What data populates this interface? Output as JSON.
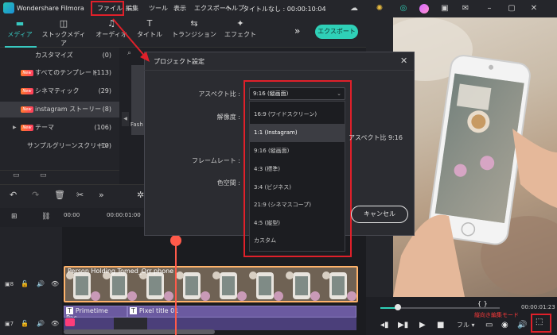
{
  "titlebar": {
    "app_name": "Wondershare Filmora",
    "menus": [
      "ファイル",
      "編集",
      "ツール",
      "表示",
      "エクスポート",
      "ヘルプ"
    ],
    "project_title": "タイトルなし : 00:00:10:04"
  },
  "toolbar": {
    "tools": [
      "メディア",
      "ストックメディア",
      "オーディオ",
      "タイトル",
      "トランジション",
      "エフェクト"
    ],
    "export_label": "エクスポート"
  },
  "left_panel": {
    "items": [
      {
        "label": "カスタマイズ",
        "count": "(0)",
        "new": false
      },
      {
        "label": "すべてのテンプレート",
        "count": "(113)",
        "new": true
      },
      {
        "label": "シネマティック",
        "count": "(29)",
        "new": true
      },
      {
        "label": "instagram ストーリー",
        "count": "(8)",
        "new": true,
        "selected": true
      },
      {
        "label": "テーマ",
        "count": "(106)",
        "new": true
      },
      {
        "label": "サンプルグリーンスクリーン",
        "count": "(10)",
        "new": false
      }
    ],
    "new_badge": "New"
  },
  "media": {
    "thumb_label": "Fash"
  },
  "dialog": {
    "title": "プロジェクト設定",
    "labels": {
      "aspect": "アスペクト比 :",
      "resolution": "解像度 :",
      "framerate": "フレームレート :",
      "colorspace": "色空間 :"
    },
    "aspect_value": "9:16 (縦画面)",
    "aspect_options": [
      "16:9 (ワイドスクリーン)",
      "1:1 (Instagram)",
      "9:16 (縦画面)",
      "4:3 (標準)",
      "3:4 (ビジネス)",
      "21:9 (シネマスコープ)",
      "4:5 (縦型)",
      "カスタム"
    ],
    "selected_index": 1,
    "aspect_info": "アスペクト比  9:16",
    "cancel_label": "キャンセル"
  },
  "timeline": {
    "ruler_times": [
      "00:00",
      "00:00:01:00"
    ],
    "video_clip_title": "Person Holding Tomed_Orr phone",
    "title_clip_1": "Primetime Pac...",
    "title_clip_2": "Pixel title 01",
    "track_numbers": [
      "8",
      "7"
    ]
  },
  "playback": {
    "zoom": "フル",
    "mode_label": "縦向き編集モード",
    "timecode": "00:00:01:23",
    "brackets": "{      }"
  }
}
